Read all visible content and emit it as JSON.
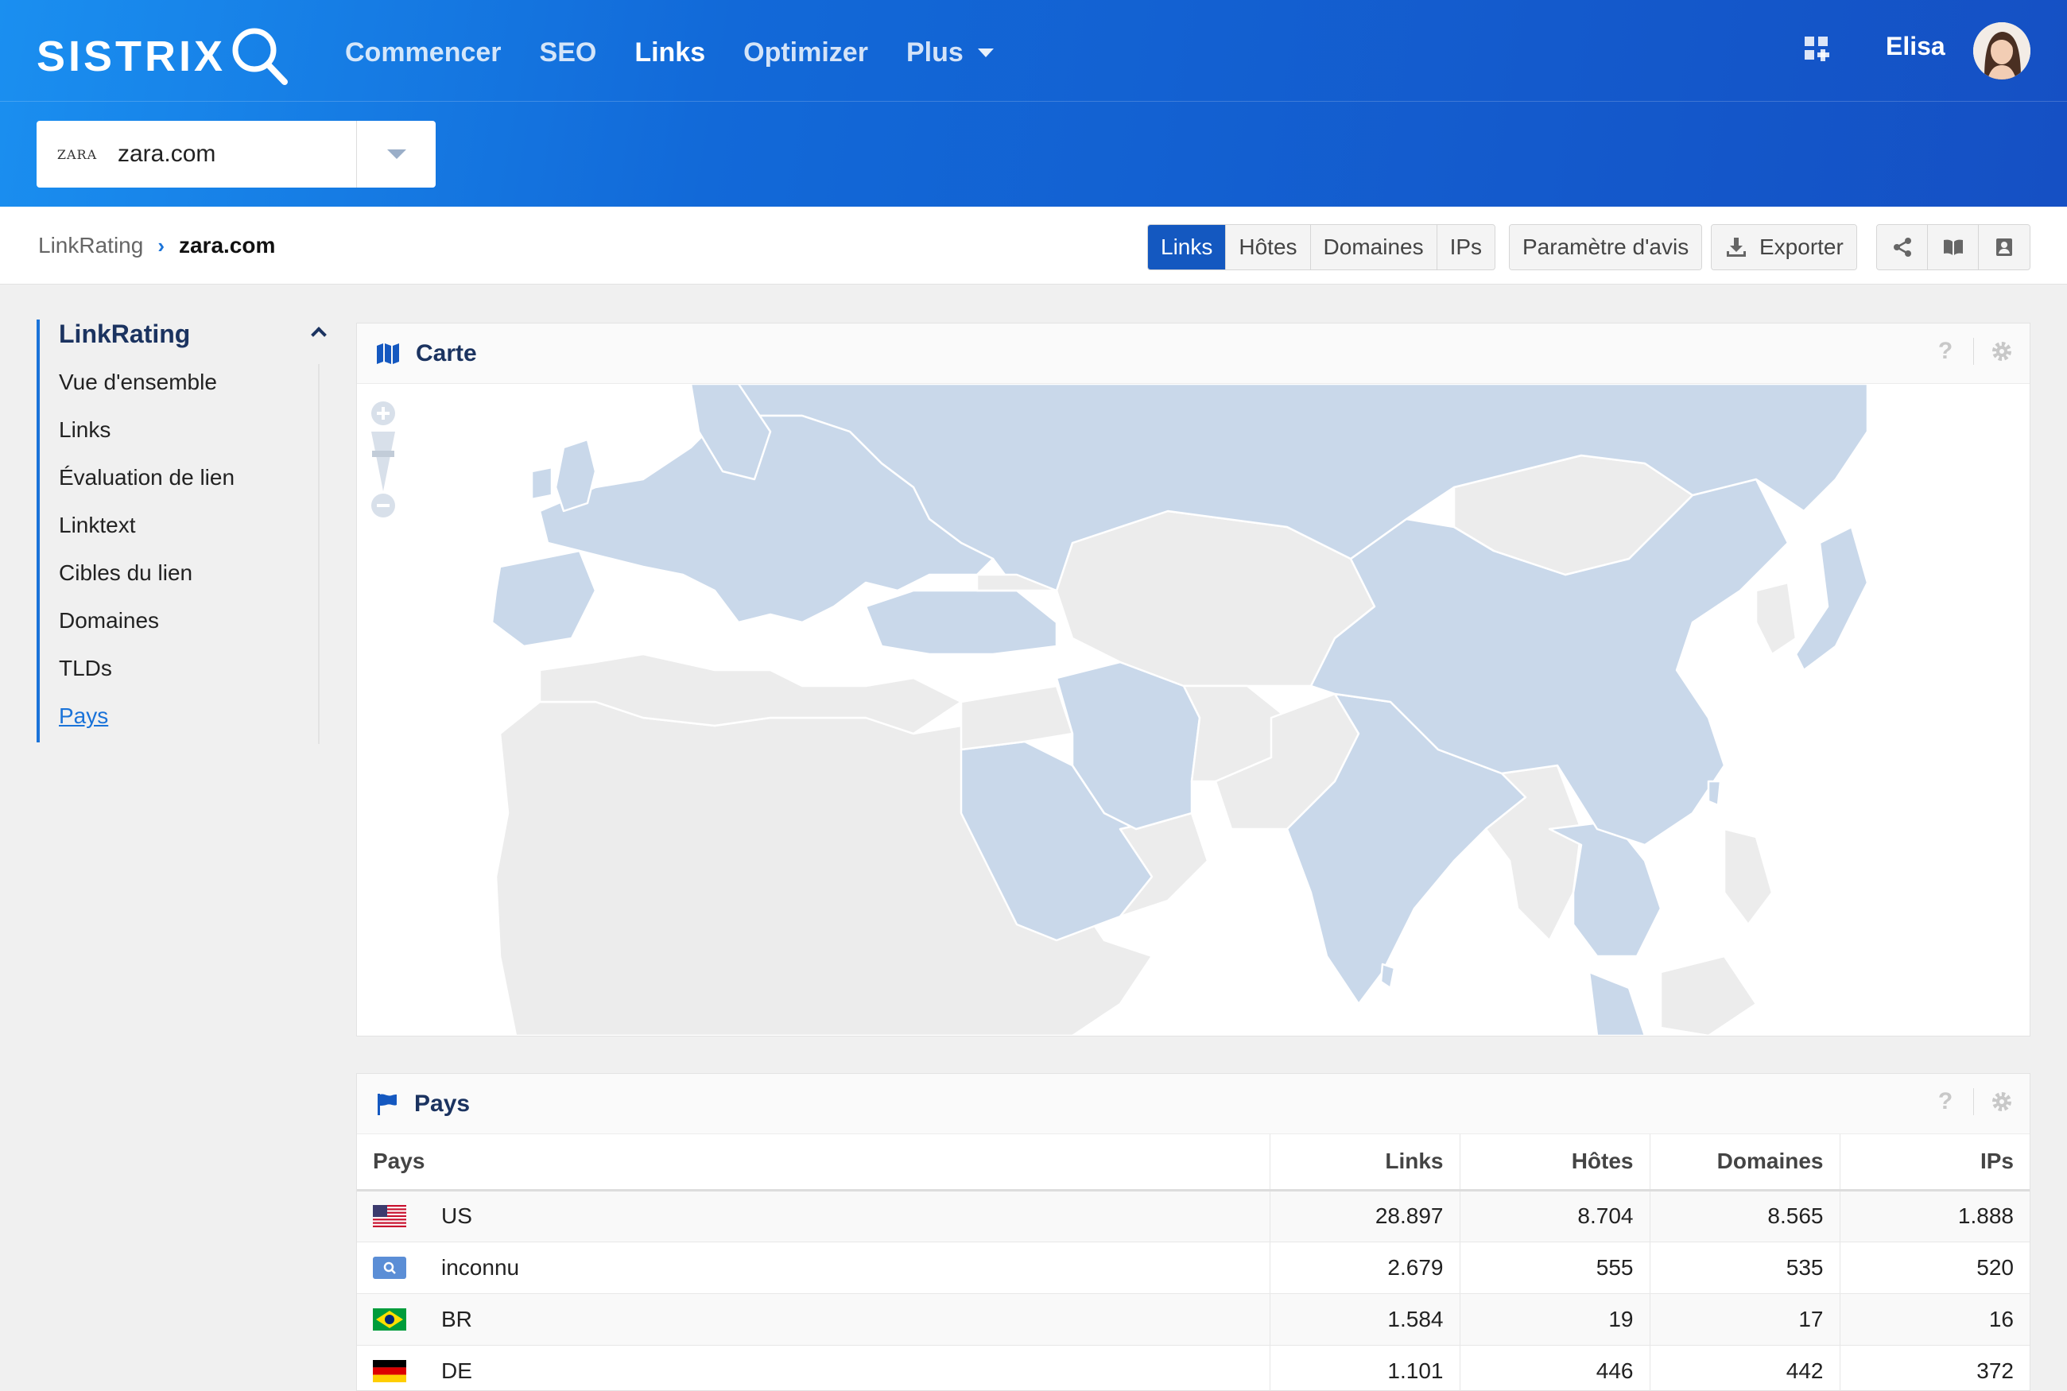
{
  "header": {
    "logo_text": "SISTRIX",
    "nav": [
      {
        "label": "Commencer"
      },
      {
        "label": "SEO"
      },
      {
        "label": "Links"
      },
      {
        "label": "Optimizer"
      },
      {
        "label": "Plus"
      }
    ],
    "active_nav": "Links",
    "user_name": "Elisa"
  },
  "domain_selector": {
    "favicon_text": "ZARA",
    "value": "zara.com"
  },
  "breadcrumb": {
    "parent": "LinkRating",
    "current": "zara.com"
  },
  "toolbar": {
    "view_tabs": [
      "Links",
      "Hôtes",
      "Domaines",
      "IPs"
    ],
    "active_tab": "Links",
    "settings_label": "Paramètre d'avis",
    "export_label": "Exporter",
    "icons": [
      "share-icon",
      "book-icon",
      "export-user-icon"
    ]
  },
  "sidebar": {
    "title": "LinkRating",
    "items": [
      {
        "label": "Vue d'ensemble"
      },
      {
        "label": "Links"
      },
      {
        "label": "Évaluation de lien"
      },
      {
        "label": "Linktext"
      },
      {
        "label": "Cibles du lien"
      },
      {
        "label": "Domaines"
      },
      {
        "label": "TLDs"
      },
      {
        "label": "Pays"
      }
    ],
    "active_item": "Pays"
  },
  "map_panel": {
    "title": "Carte",
    "help_icon": "?",
    "colors": {
      "highlight": "#c9d8ea",
      "neutral": "#ececec",
      "border": "#ffffff"
    }
  },
  "table_panel": {
    "title": "Pays",
    "help_icon": "?",
    "columns": [
      "Pays",
      "Links",
      "Hôtes",
      "Domaines",
      "IPs"
    ],
    "rows": [
      {
        "country": "US",
        "flag": "us-flag",
        "links": "28.897",
        "hosts": "8.704",
        "domains": "8.565",
        "ips": "1.888"
      },
      {
        "country": "inconnu",
        "flag": "unknown-flag",
        "links": "2.679",
        "hosts": "555",
        "domains": "535",
        "ips": "520"
      },
      {
        "country": "BR",
        "flag": "br-flag",
        "links": "1.584",
        "hosts": "19",
        "domains": "17",
        "ips": "16"
      },
      {
        "country": "DE",
        "flag": "de-flag",
        "links": "1.101",
        "hosts": "446",
        "domains": "442",
        "ips": "372"
      }
    ]
  }
}
